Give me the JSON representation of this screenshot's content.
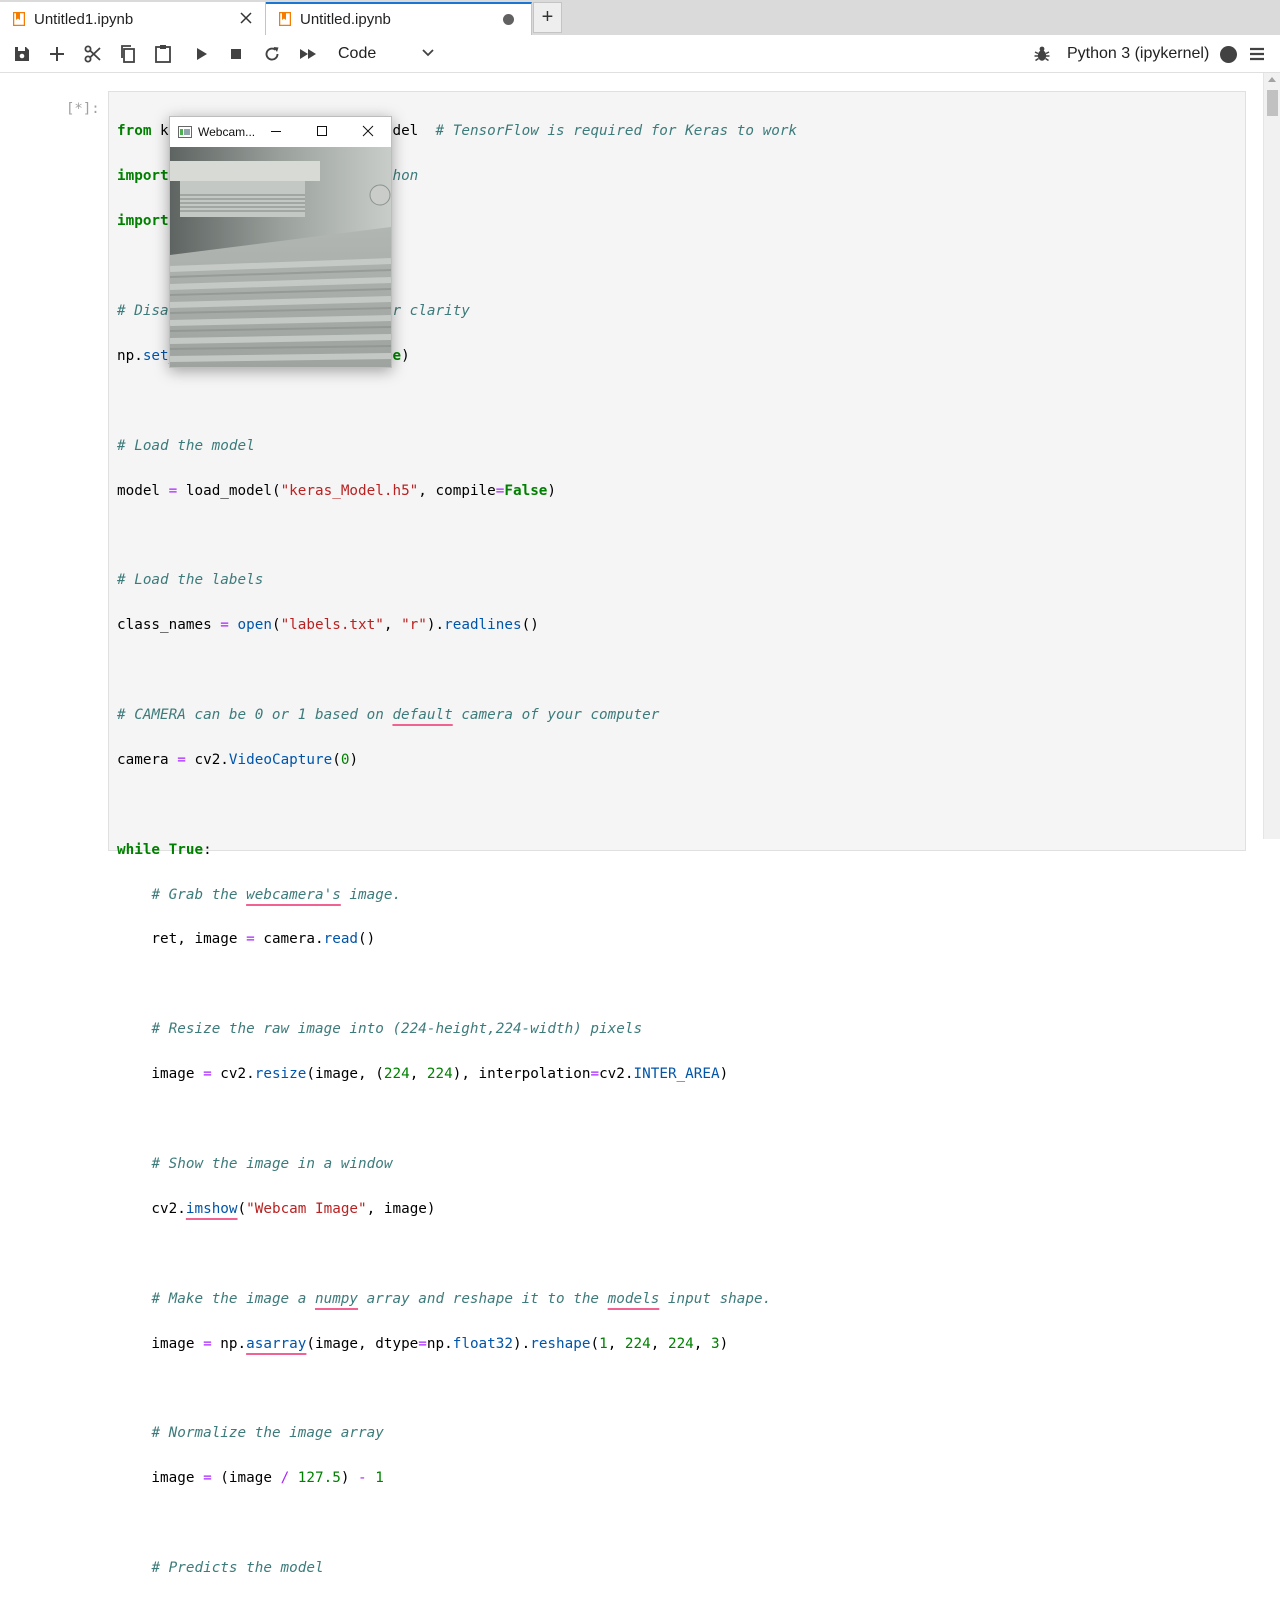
{
  "tabs": [
    {
      "label": "Untitled1.ipynb",
      "active": false,
      "close_icon": "close-icon"
    },
    {
      "label": "Untitled.ipynb",
      "active": true,
      "status_icon": "unsaved-dot-icon"
    }
  ],
  "new_tab_label": "+",
  "toolbar": {
    "cell_type": "Code",
    "kernel": "Python 3 (ipykernel)",
    "icons": [
      "save-icon",
      "add-cell-icon",
      "cut-icon",
      "copy-icon",
      "paste-icon",
      "run-icon",
      "stop-icon",
      "restart-icon",
      "run-all-icon",
      "bug-icon",
      "kernel-status-icon",
      "menu-icon"
    ]
  },
  "cell": {
    "prompt": "[*]:"
  },
  "webcam_window": {
    "title": "Webcam...",
    "min_glyph": "—",
    "max_glyph": "☐",
    "close_glyph": "✕"
  },
  "colors": {
    "accent": "#1976d2",
    "keyword": "#008000",
    "comment": "#3d7b7b",
    "string": "#ba2121",
    "operator": "#aa22ff"
  }
}
